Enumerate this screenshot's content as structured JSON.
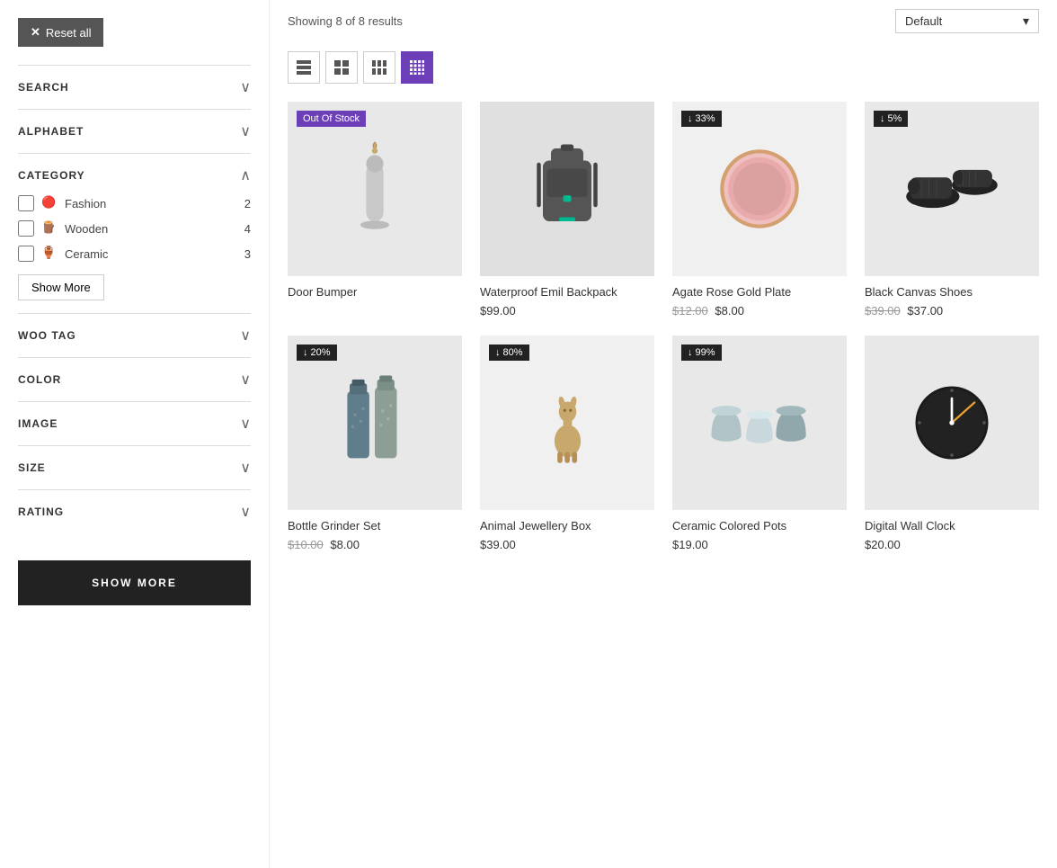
{
  "topBar": {
    "resultsText": "Showing 8 of 8 results",
    "sortLabel": "Default",
    "sortChevron": "▾"
  },
  "gridControls": [
    {
      "id": "list-1",
      "active": false
    },
    {
      "id": "grid-2",
      "active": false
    },
    {
      "id": "grid-3",
      "active": false
    },
    {
      "id": "grid-4",
      "active": true
    }
  ],
  "sidebar": {
    "resetLabel": "Reset all",
    "filters": [
      {
        "id": "search",
        "title": "SEARCH",
        "expanded": false
      },
      {
        "id": "alphabet",
        "title": "ALPHABET",
        "expanded": false
      },
      {
        "id": "category",
        "title": "CATEGORY",
        "expanded": true
      },
      {
        "id": "woo-tag",
        "title": "WOO TAG",
        "expanded": false
      },
      {
        "id": "color",
        "title": "COLOR",
        "expanded": false
      },
      {
        "id": "image",
        "title": "IMAGE",
        "expanded": false
      },
      {
        "id": "size",
        "title": "SIZE",
        "expanded": false
      },
      {
        "id": "rating",
        "title": "RATING",
        "expanded": false
      }
    ],
    "categories": [
      {
        "name": "Fashion",
        "count": 2,
        "icon": "🔴"
      },
      {
        "name": "Wooden",
        "count": 4,
        "icon": "🪵"
      },
      {
        "name": "Ceramic",
        "count": 3,
        "icon": "🏺"
      }
    ],
    "showMoreLabel": "Show More",
    "footerBtnLabel": "SHOW MORE"
  },
  "products": [
    {
      "id": "door-bumper",
      "name": "Door Bumper",
      "badge": "Out Of Stock",
      "badgeType": "out-of-stock",
      "price": null,
      "originalPrice": null,
      "salePrice": null,
      "imgType": "door-bumper"
    },
    {
      "id": "waterproof-backpack",
      "name": "Waterproof Emil Backpack",
      "badge": null,
      "badgeType": null,
      "price": "$99.00",
      "originalPrice": null,
      "salePrice": null,
      "imgType": "backpack"
    },
    {
      "id": "agate-rose-plate",
      "name": "Agate Rose Gold Plate",
      "badge": "↓ 33%",
      "badgeType": "discount",
      "price": null,
      "originalPrice": "$12.00",
      "salePrice": "$8.00",
      "imgType": "plate"
    },
    {
      "id": "black-canvas-shoes",
      "name": "Black Canvas Shoes",
      "badge": "↓ 5%",
      "badgeType": "discount",
      "price": null,
      "originalPrice": "$39.00",
      "salePrice": "$37.00",
      "imgType": "shoes"
    },
    {
      "id": "bottle-grinder",
      "name": "Bottle Grinder Set",
      "badge": "↓ 20%",
      "badgeType": "discount",
      "price": null,
      "originalPrice": "$10.00",
      "salePrice": "$8.00",
      "imgType": "grinder"
    },
    {
      "id": "animal-jewellery",
      "name": "Animal Jewellery Box",
      "badge": "↓ 80%",
      "badgeType": "discount",
      "price": "$39.00",
      "originalPrice": null,
      "salePrice": null,
      "imgType": "animal"
    },
    {
      "id": "ceramic-pots",
      "name": "Ceramic Colored Pots",
      "badge": "↓ 99%",
      "badgeType": "discount",
      "price": "$19.00",
      "originalPrice": null,
      "salePrice": null,
      "imgType": "pots"
    },
    {
      "id": "digital-wall-clock",
      "name": "Digital Wall Clock",
      "badge": null,
      "badgeType": null,
      "price": "$20.00",
      "originalPrice": null,
      "salePrice": null,
      "imgType": "clock"
    }
  ]
}
